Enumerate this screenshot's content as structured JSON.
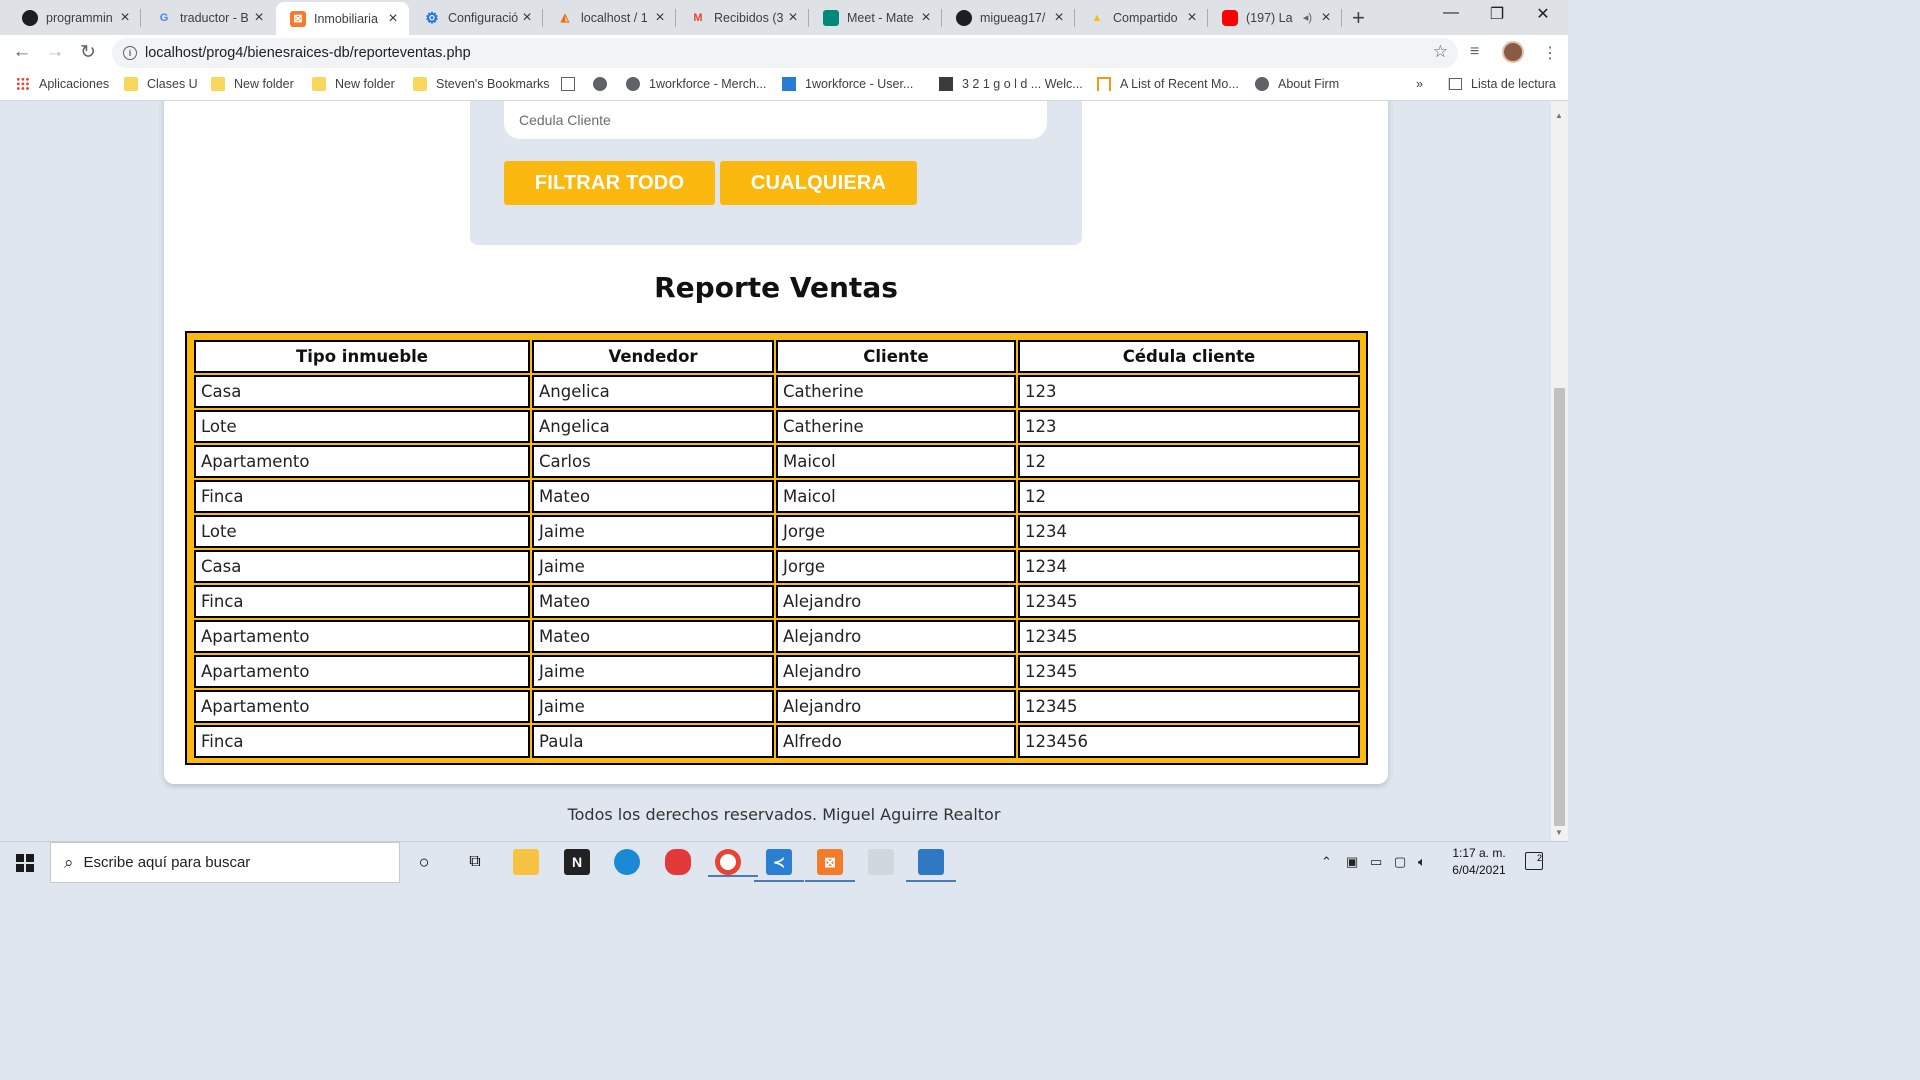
{
  "browser": {
    "tabs": [
      {
        "label": "programmin",
        "icon": "github-icon"
      },
      {
        "label": "traductor - B",
        "icon": "google-icon"
      },
      {
        "label": "Inmobiliaria",
        "icon": "xampp-icon",
        "active": true
      },
      {
        "label": "Configuració",
        "icon": "settings-gear-icon"
      },
      {
        "label": "localhost / 1",
        "icon": "phpmyadmin-icon"
      },
      {
        "label": "Recibidos (3",
        "icon": "gmail-icon"
      },
      {
        "label": "Meet - Mate",
        "icon": "meet-icon"
      },
      {
        "label": "migueag17/",
        "icon": "github-icon"
      },
      {
        "label": "Compartido",
        "icon": "google-drive-icon"
      },
      {
        "label": "(197) La",
        "icon": "youtube-icon"
      }
    ],
    "url": "localhost/prog4/bienesraices-db/reporteventas.php",
    "bookmarks": [
      {
        "label": "Aplicaciones",
        "icon": "apps-grid-icon"
      },
      {
        "label": "Clases U",
        "icon": "folder-icon"
      },
      {
        "label": "New folder",
        "icon": "folder-icon"
      },
      {
        "label": "New folder",
        "icon": "folder-icon"
      },
      {
        "label": "Steven's Bookmarks",
        "icon": "folder-icon"
      },
      {
        "label": "",
        "icon": "document-icon"
      },
      {
        "label": "",
        "icon": "globe-icon"
      },
      {
        "label": "1workforce - Merch...",
        "icon": "globe-icon"
      },
      {
        "label": "1workforce - User...",
        "icon": "workforce-icon"
      },
      {
        "label": "3 2 1 g o l d ... Welc...",
        "icon": "gold-321-icon"
      },
      {
        "label": "A List of Recent Mo...",
        "icon": "house-icon"
      },
      {
        "label": "About Firm",
        "icon": "globe-icon"
      }
    ],
    "overflow": "»",
    "reading_list": "Lista de lectura"
  },
  "page": {
    "filter": {
      "cedula_placeholder": "Cedula Cliente",
      "btn_filtrar_todo": "FILTRAR TODO",
      "btn_cualquiera": "CUALQUIERA"
    },
    "report_title": "Reporte Ventas",
    "table": {
      "headers": [
        "Tipo inmueble",
        "Vendedor",
        "Cliente",
        "Cédula cliente"
      ],
      "rows": [
        [
          "Casa",
          "Angelica",
          "Catherine",
          "123"
        ],
        [
          "Lote",
          "Angelica",
          "Catherine",
          "123"
        ],
        [
          "Apartamento",
          "Carlos",
          "Maicol",
          "12"
        ],
        [
          "Finca",
          "Mateo",
          "Maicol",
          "12"
        ],
        [
          "Lote",
          "Jaime",
          "Jorge",
          "1234"
        ],
        [
          "Casa",
          "Jaime",
          "Jorge",
          "1234"
        ],
        [
          "Finca",
          "Mateo",
          "Alejandro",
          "12345"
        ],
        [
          "Apartamento",
          "Mateo",
          "Alejandro",
          "12345"
        ],
        [
          "Apartamento",
          "Jaime",
          "Alejandro",
          "12345"
        ],
        [
          "Apartamento",
          "Jaime",
          "Alejandro",
          "12345"
        ],
        [
          "Finca",
          "Paula",
          "Alfredo",
          "123456"
        ]
      ]
    },
    "footer": "Todos los derechos reservados. Miguel Aguirre Realtor",
    "colors": {
      "accent": "#fbb80f",
      "background": "#dfe6ef"
    }
  },
  "taskbar": {
    "search_placeholder": "Escribe aquí para buscar",
    "time": "1:17 a. m.",
    "date": "6/04/2021",
    "notification_count": "2"
  }
}
